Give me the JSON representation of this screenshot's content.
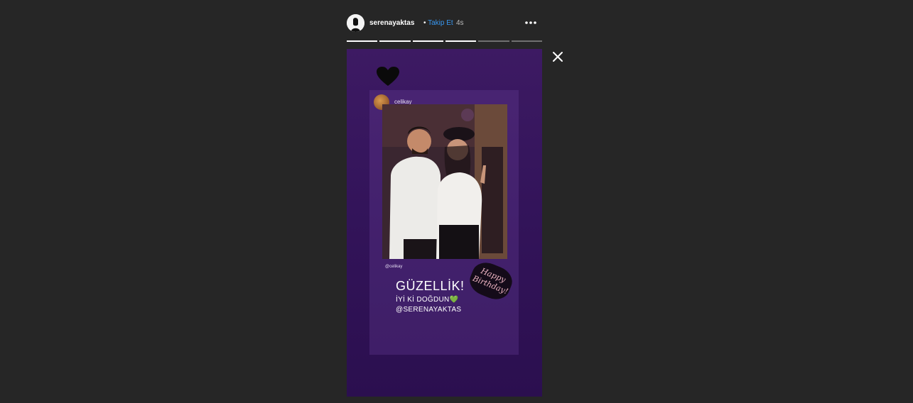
{
  "header": {
    "username": "serenayaktas",
    "separator": " •",
    "follow_label": "Takip Et",
    "time_ago": "4s"
  },
  "progress": {
    "total_segments": 6,
    "completed_segments": 4
  },
  "story": {
    "shared_post": {
      "username": "celikay",
      "mention": "@celikay"
    },
    "caption": {
      "title": "GÜZELLİK!",
      "line1": "İYİ Kİ DOĞDUN💚",
      "line2": "@SERENAYAKTAS"
    },
    "sticker_text": "Happy Birthday!"
  },
  "icons": {
    "more": "more-dots-icon",
    "close": "close-icon",
    "heart": "black-heart-icon"
  },
  "colors": {
    "background": "#262626",
    "follow": "#3897f0",
    "story_bg": "#33145a"
  }
}
